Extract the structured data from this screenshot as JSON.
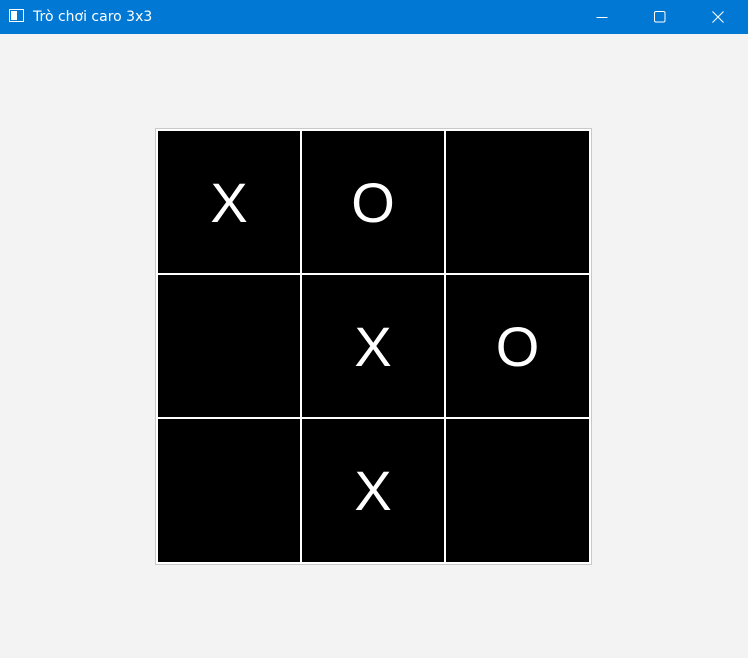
{
  "window": {
    "title": "Trò chơi caro 3x3",
    "titlebar_color": "#0078d4",
    "background_color": "#f3f3f3"
  },
  "controls": {
    "minimize_icon": "minimize-icon",
    "maximize_icon": "maximize-icon",
    "close_icon": "close-icon"
  },
  "board": {
    "cell_color": "#000000",
    "mark_color": "#ffffff",
    "grid_color": "#ffffff",
    "cells": [
      [
        "X",
        "O",
        ""
      ],
      [
        "",
        "X",
        "O"
      ],
      [
        "",
        "X",
        ""
      ]
    ]
  }
}
